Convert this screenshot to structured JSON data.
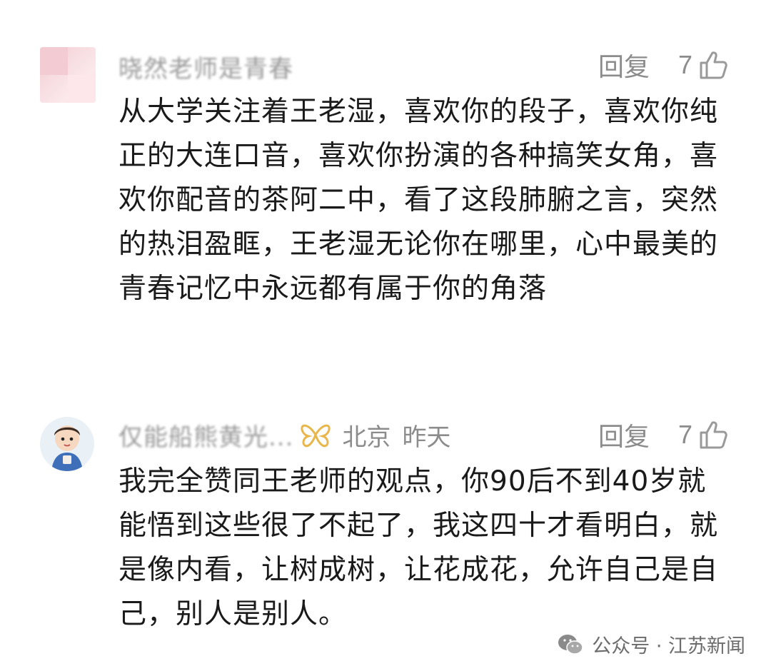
{
  "comments": [
    {
      "nickname": "晓然老师是青春",
      "reply_label": "回复",
      "likes": "7",
      "text": "从大学关注着王老湿，喜欢你的段子，喜欢你纯正的大连口音，喜欢你扮演的各种搞笑女角，喜欢你配音的茶阿二中，看了这段肺腑之言，突然的热泪盈眶，王老湿无论你在哪里，心中最美的青春记忆中永远都有属于你的角落"
    },
    {
      "nickname": "仅能船熊黄光...",
      "location": "北京",
      "time": "昨天",
      "reply_label": "回复",
      "likes": "7",
      "text": "我完全赞同王老师的观点，你90后不到40岁就能悟到这些很了不起了，我这四十才看明白，就是像内看，让树成树，让花成花，允许自己是自己，别人是别人。"
    }
  ],
  "watermark": {
    "text": "公众号 · 江苏新闻"
  },
  "colors": {
    "text": "#1a1a1a",
    "meta": "#8c8c8c",
    "badge": "#e8b64a"
  },
  "icons": {
    "like": "thumbs-up-icon",
    "badge": "butterfly-badge-icon",
    "watermark": "wechat-icon"
  }
}
